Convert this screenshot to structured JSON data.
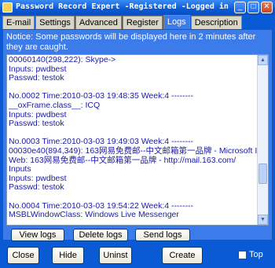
{
  "window": {
    "title": "Password Record Expert -Registered -Logged in",
    "controls": {
      "minimize": "_",
      "maximize": "□",
      "close": "✕"
    }
  },
  "tabs": [
    {
      "label": "E-mail"
    },
    {
      "label": "Settings"
    },
    {
      "label": "Advanced"
    },
    {
      "label": "Register"
    },
    {
      "label": "Logs",
      "active": true
    },
    {
      "label": "Description"
    }
  ],
  "logs": {
    "notice": "Notice: Some passwords will be displayed here in 2 minutes after they are caught.",
    "lines": [
      "00060140(298,222): Skype->",
      "Inputs: pwdbest",
      "Passwd: testok",
      "",
      "No.0002 Time:2010-03-03 19:48:35 Week:4 --------",
      "__oxFrame.class__: ICQ",
      "Inputs: pwdbest",
      "Passwd: testok",
      "",
      "No.0003 Time:2010-03-03 19:49:03 Week:4 --------",
      "00030e40(894,349): 163网易免费邮--中文邮箱第一品牌 - Microsoft Internet Explorer",
      "Web: 163网易免费邮--中文邮箱第一品牌 - http://mail.163.com/",
      "Inputs",
      "Inputs: pwdbest",
      "Passwd: testok",
      "",
      "No.0004 Time:2010-03-03 19:54:22 Week:4 --------",
      "MSBLWindowClass: Windows Live Messenger"
    ],
    "buttons": {
      "view": "View logs",
      "delete": "Delete logs",
      "send": "Send logs"
    }
  },
  "bottom": {
    "close": "Close",
    "hide": "Hide",
    "uninst": "Uninst",
    "create": "Create",
    "top_label": "Top",
    "top_checked": false
  },
  "icons": {
    "scroll_up": "scroll-up-arrow-icon",
    "scroll_down": "scroll-down-arrow-icon"
  }
}
